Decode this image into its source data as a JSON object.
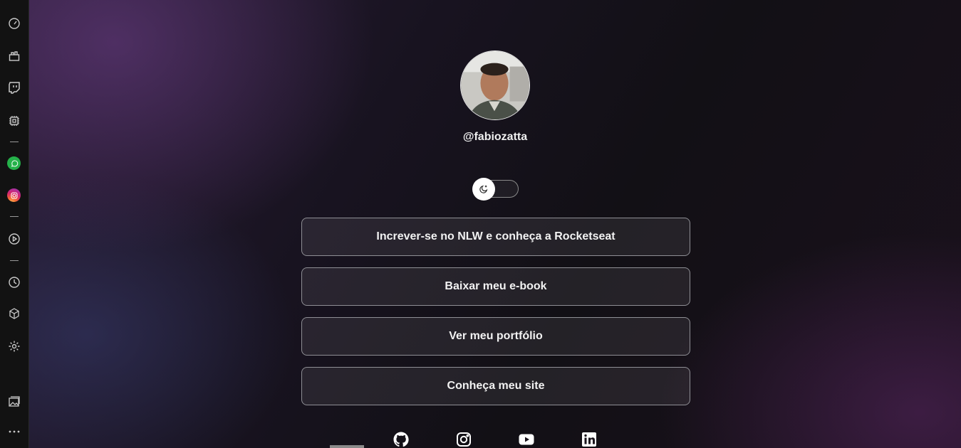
{
  "sidebar": {
    "items": [
      {
        "icon": "speed-dial-icon"
      },
      {
        "icon": "bag-icon"
      },
      {
        "icon": "twitch-icon"
      },
      {
        "icon": "chip-icon"
      },
      {
        "icon": "whatsapp-icon"
      },
      {
        "icon": "instagram-icon"
      },
      {
        "icon": "player-icon"
      },
      {
        "icon": "history-icon"
      },
      {
        "icon": "cube-icon"
      },
      {
        "icon": "gear-icon"
      },
      {
        "icon": "gallery-icon"
      },
      {
        "icon": "more-dots-icon"
      }
    ]
  },
  "profile": {
    "handle": "@fabiozatta",
    "avatar_icon": "profile-photo"
  },
  "theme_switch": {
    "state": "dark",
    "icon": "moon-icon"
  },
  "links": [
    {
      "label": "Increver-se no NLW e conheça a Rocketseat"
    },
    {
      "label": "Baixar meu e-book"
    },
    {
      "label": "Ver meu portfólio"
    },
    {
      "label": "Conheça meu site"
    }
  ],
  "social": [
    {
      "icon": "github-icon"
    },
    {
      "icon": "instagram-icon"
    },
    {
      "icon": "youtube-icon"
    },
    {
      "icon": "linkedin-icon"
    }
  ],
  "colors": {
    "text": "#f2f2f2",
    "button_border": "#8f8f95"
  }
}
